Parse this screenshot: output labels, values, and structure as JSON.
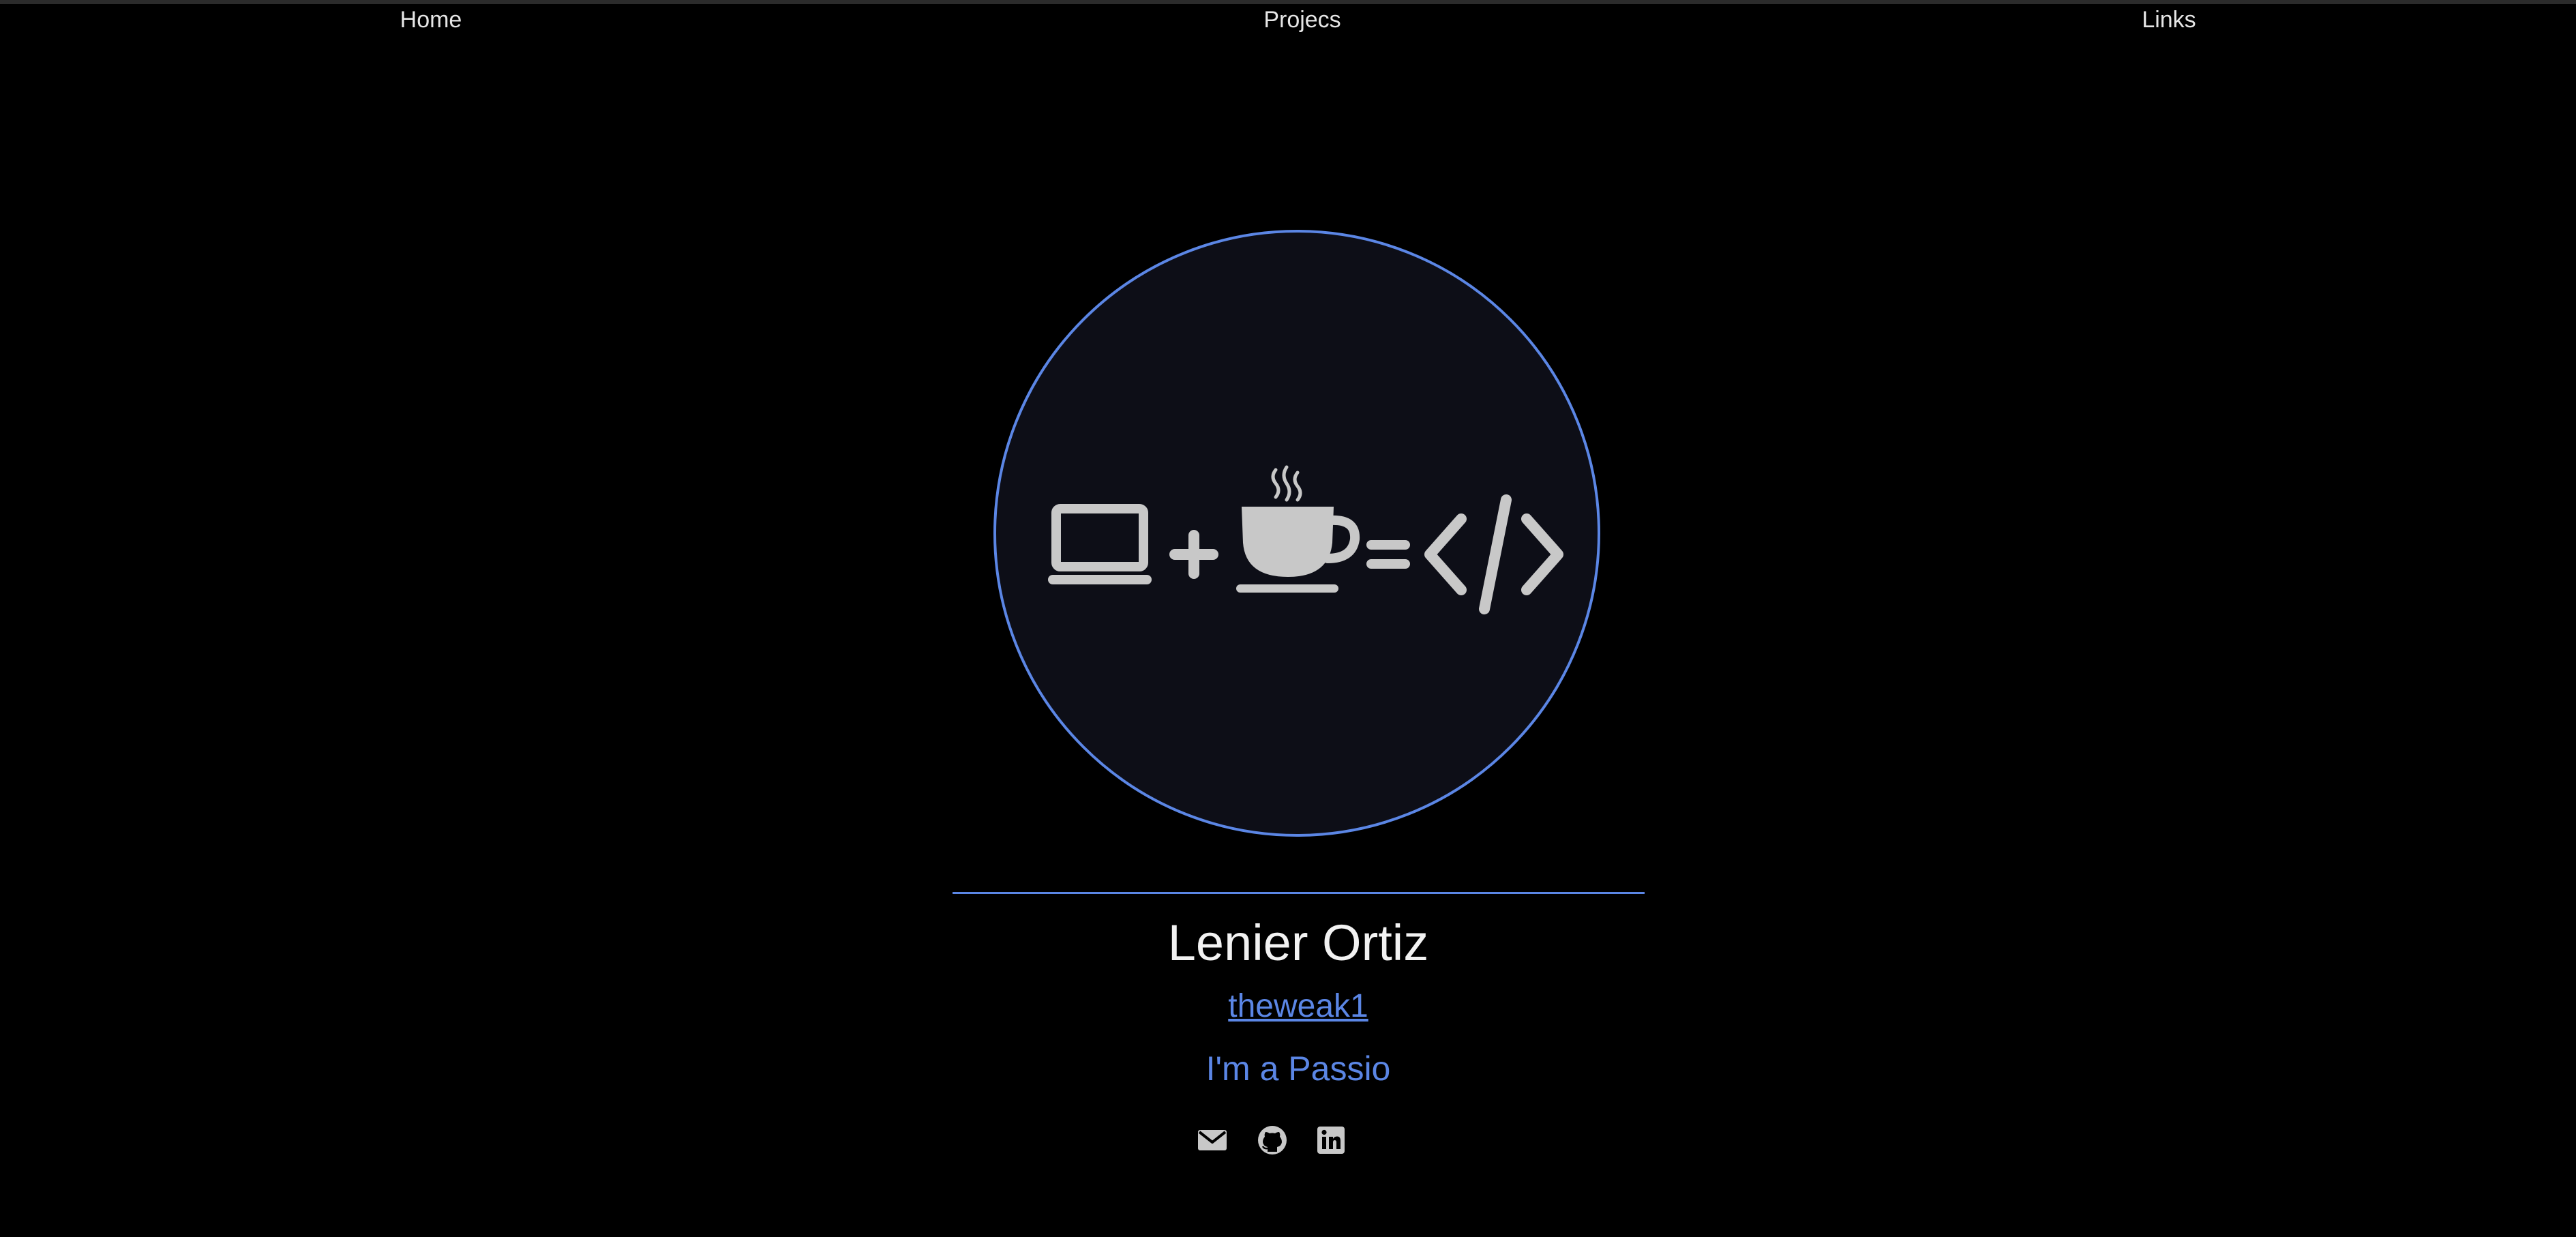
{
  "nav": {
    "items": [
      {
        "label": "Home"
      },
      {
        "label": "Projecs"
      },
      {
        "label": "Links"
      }
    ]
  },
  "profile": {
    "name": "Lenier Ortiz",
    "handle": "theweak1",
    "tagline": "I'm a Passio"
  },
  "socials": [
    {
      "icon": "envelope-icon"
    },
    {
      "icon": "github-icon"
    },
    {
      "icon": "linkedin-icon"
    }
  ],
  "colors": {
    "accent": "#5b86e5",
    "background": "#000000",
    "avatar_background": "#0d0e17",
    "icon_gray": "#c8c8c8"
  }
}
